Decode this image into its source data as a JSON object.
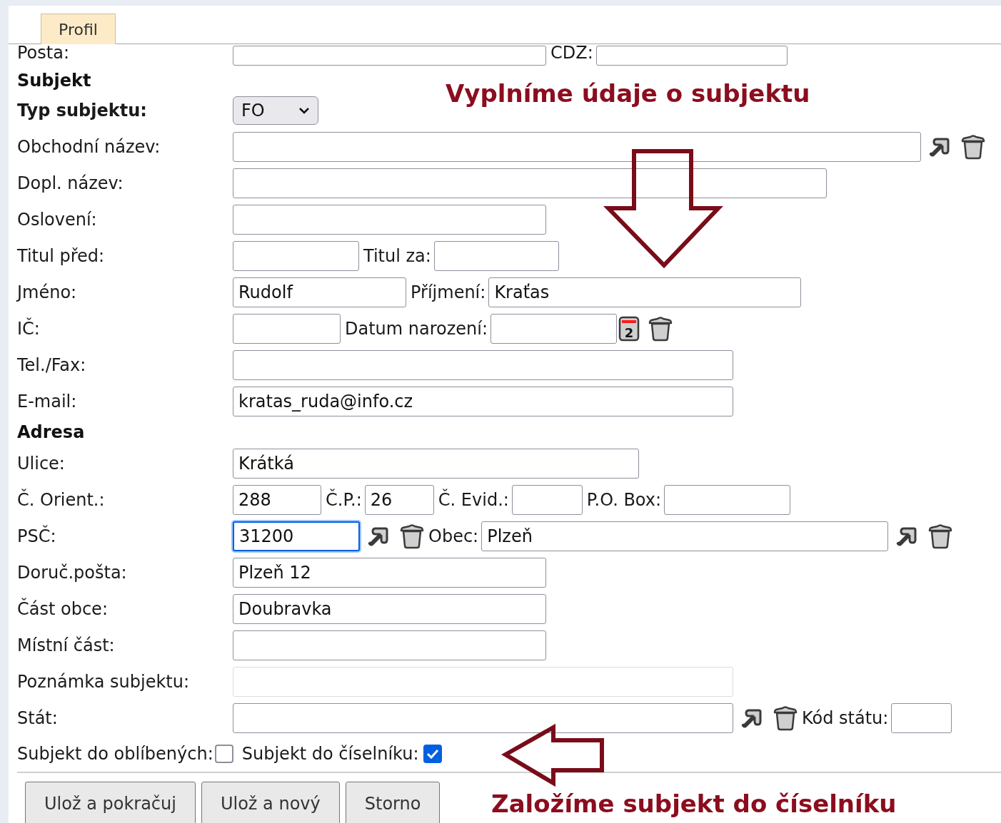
{
  "tab": {
    "label": "Profil",
    "selected": true
  },
  "rows": [
    {
      "kind": "field",
      "label": "Posta:",
      "bold": false,
      "items": [
        {
          "kind": "input",
          "value": ""
        },
        {
          "kind": "label",
          "text": "CDZ:"
        },
        {
          "kind": "input",
          "value": ""
        }
      ]
    },
    {
      "kind": "heading",
      "text": "Subjekt"
    },
    {
      "kind": "field",
      "label": "Typ subjektu:",
      "bold": true,
      "items": [
        {
          "kind": "select",
          "value": "FO"
        }
      ]
    },
    {
      "kind": "field",
      "label": "Obchodní název:",
      "bold": false,
      "items": [
        {
          "kind": "input",
          "value": ""
        },
        {
          "kind": "pick"
        },
        {
          "kind": "clear"
        }
      ]
    },
    {
      "kind": "field",
      "label": "Dopl. název:",
      "bold": false,
      "items": [
        {
          "kind": "input",
          "value": ""
        }
      ]
    },
    {
      "kind": "field",
      "label": "Oslovení:",
      "bold": false,
      "items": [
        {
          "kind": "input",
          "value": ""
        }
      ]
    },
    {
      "kind": "field",
      "label": "Titul před:",
      "bold": false,
      "items": [
        {
          "kind": "input",
          "value": ""
        },
        {
          "kind": "label",
          "text": "Titul za:"
        },
        {
          "kind": "input",
          "value": ""
        }
      ]
    },
    {
      "kind": "field",
      "label": "Jméno:",
      "bold": false,
      "items": [
        {
          "kind": "input",
          "value": "Rudolf"
        },
        {
          "kind": "label",
          "text": "Příjmení:"
        },
        {
          "kind": "input",
          "value": "Kraťas"
        }
      ]
    },
    {
      "kind": "field",
      "label": "IČ:",
      "bold": false,
      "items": [
        {
          "kind": "input",
          "value": ""
        },
        {
          "kind": "label",
          "text": "Datum narození:"
        },
        {
          "kind": "input",
          "value": ""
        },
        {
          "kind": "calendar",
          "text": "2"
        },
        {
          "kind": "clear"
        }
      ]
    },
    {
      "kind": "field",
      "label": "Tel./Fax:",
      "bold": false,
      "items": [
        {
          "kind": "input",
          "value": ""
        }
      ]
    },
    {
      "kind": "field",
      "label": "E-mail:",
      "bold": false,
      "items": [
        {
          "kind": "input",
          "value": "kratas_ruda@info.cz"
        }
      ]
    },
    {
      "kind": "heading",
      "text": "Adresa"
    },
    {
      "kind": "field",
      "label": "Ulice:",
      "bold": false,
      "items": [
        {
          "kind": "input",
          "value": "Krátká"
        }
      ]
    },
    {
      "kind": "field",
      "label": "Č. Orient.:",
      "bold": false,
      "items": [
        {
          "kind": "input",
          "value": "288"
        },
        {
          "kind": "label",
          "text": "Č.P.:"
        },
        {
          "kind": "input",
          "value": "26"
        },
        {
          "kind": "label",
          "text": "Č. Evid.:"
        },
        {
          "kind": "input",
          "value": ""
        },
        {
          "kind": "label",
          "text": "P.O. Box:"
        },
        {
          "kind": "input",
          "value": ""
        }
      ]
    },
    {
      "kind": "field",
      "label": "PSČ:",
      "bold": false,
      "items": [
        {
          "kind": "input",
          "value": "31200",
          "focused": true
        },
        {
          "kind": "pick"
        },
        {
          "kind": "clear"
        },
        {
          "kind": "label",
          "text": "Obec:"
        },
        {
          "kind": "input",
          "value": "Plzeň"
        },
        {
          "kind": "pick"
        },
        {
          "kind": "clear"
        }
      ]
    },
    {
      "kind": "field",
      "label": "Doruč.pošta:",
      "bold": false,
      "items": [
        {
          "kind": "input",
          "value": "Plzeň 12"
        }
      ]
    },
    {
      "kind": "field",
      "label": "Část obce:",
      "bold": false,
      "items": [
        {
          "kind": "input",
          "value": "Doubravka"
        }
      ]
    },
    {
      "kind": "field",
      "label": "Místní část:",
      "bold": false,
      "items": [
        {
          "kind": "input",
          "value": ""
        }
      ]
    },
    {
      "kind": "field",
      "label": "Poznámka subjektu:",
      "bold": false,
      "items": [
        {
          "kind": "input",
          "value": "",
          "disabled": true
        }
      ]
    },
    {
      "kind": "field",
      "label": "Stát:",
      "bold": false,
      "items": [
        {
          "kind": "input",
          "value": ""
        },
        {
          "kind": "pick"
        },
        {
          "kind": "clear"
        },
        {
          "kind": "label",
          "text": "Kód státu:"
        },
        {
          "kind": "input",
          "value": ""
        }
      ]
    },
    {
      "kind": "checks",
      "items": [
        {
          "kind": "label",
          "text": "Subjekt do oblíbených:"
        },
        {
          "kind": "checkbox",
          "checked": false
        },
        {
          "kind": "label",
          "text": "Subjekt do číselníku:"
        },
        {
          "kind": "checkbox",
          "checked": true
        }
      ]
    }
  ],
  "buttons": [
    "Ulož a pokračuj",
    "Ulož a nový",
    "Storno"
  ],
  "annotations": [
    {
      "text": "Vyplníme údaje o subjektu"
    },
    {
      "text": "Založíme subjekt do číselníku"
    }
  ]
}
